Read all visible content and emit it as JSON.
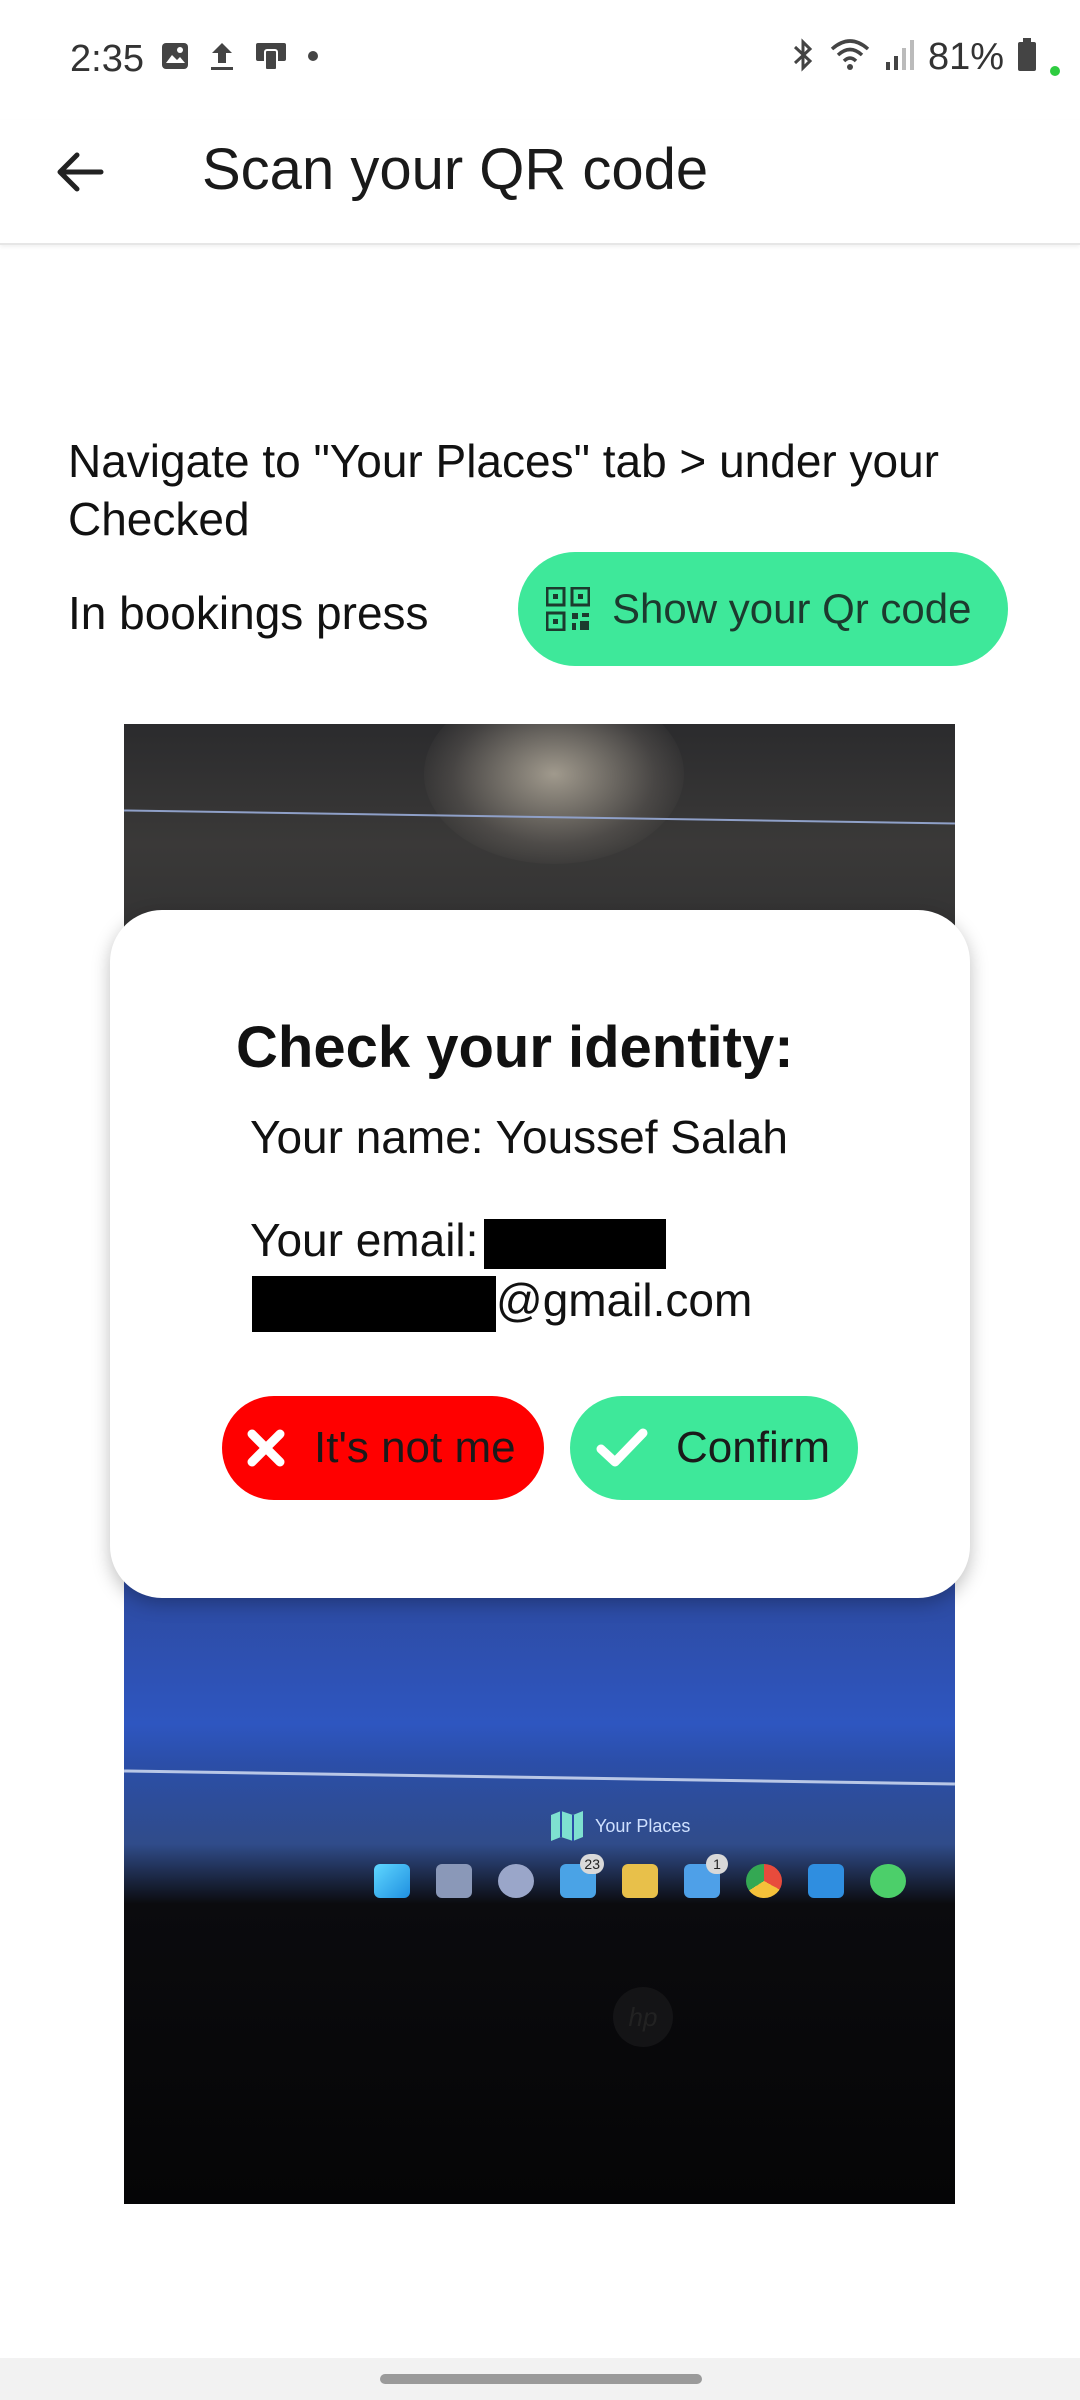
{
  "status_bar": {
    "time": "2:35",
    "battery_text": "81%",
    "left_icons": [
      "image-icon",
      "upload-icon",
      "cast-icon",
      "dot-icon"
    ],
    "right_icons": [
      "bluetooth-icon",
      "wifi-icon",
      "signal-icon",
      "battery-icon"
    ]
  },
  "app_bar": {
    "title": "Scan your QR code",
    "back_icon": "arrow-left-icon"
  },
  "instructions": {
    "line1": "Navigate to \"Your Places\" tab > under your Checked",
    "line2": "In bookings press",
    "qr_button_label": "Show your Qr code",
    "qr_button_icon": "qr-code-icon",
    "accent_color": "#3ee89a"
  },
  "camera_preview": {
    "places_text": "Your Places",
    "taskbar_badges": [
      "23",
      "1"
    ]
  },
  "dialog": {
    "title": "Check your identity:",
    "name_line": "Your name: Youssef Salah",
    "email_prefix": "Your email:",
    "email_suffix": "@gmail.com",
    "not_me_label": "It's not me",
    "not_me_color": "#ff0000",
    "confirm_label": "Confirm",
    "confirm_color": "#3ee89a"
  }
}
